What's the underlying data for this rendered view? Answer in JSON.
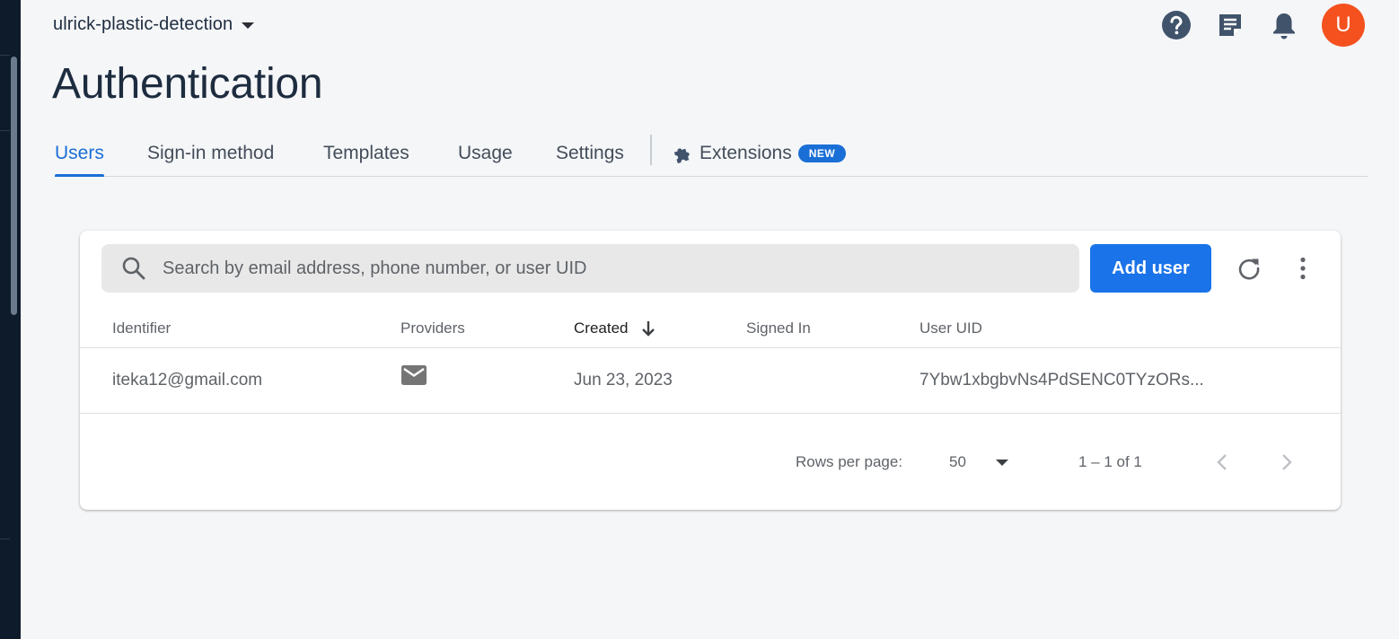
{
  "header": {
    "project_name": "ulrick-plastic-detection",
    "avatar_letter": "U",
    "avatar_color": "#f4511e"
  },
  "page": {
    "title": "Authentication"
  },
  "tabs": [
    {
      "label": "Users",
      "active": true
    },
    {
      "label": "Sign-in method",
      "active": false
    },
    {
      "label": "Templates",
      "active": false
    },
    {
      "label": "Usage",
      "active": false
    },
    {
      "label": "Settings",
      "active": false
    },
    {
      "label": "Extensions",
      "active": false,
      "badge": "NEW"
    }
  ],
  "toolbar": {
    "search_placeholder": "Search by email address, phone number, or user UID",
    "add_user_label": "Add user"
  },
  "table": {
    "columns": [
      "Identifier",
      "Providers",
      "Created",
      "Signed In",
      "User UID"
    ],
    "sorted_column": "Created",
    "rows": [
      {
        "identifier": "iteka12@gmail.com",
        "provider_icon": "email-icon",
        "created": "Jun 23, 2023",
        "signed_in": "",
        "user_uid": "7Ybw1xbgbvNs4PdSENC0TYzORs..."
      }
    ]
  },
  "pagination": {
    "rows_per_page_label": "Rows per page:",
    "rows_per_page_value": "50",
    "range_text": "1 – 1 of 1"
  },
  "colors": {
    "accent": "#1a73e8",
    "tab_active": "#1a6fd6",
    "sidebar": "#0e1b2b"
  }
}
